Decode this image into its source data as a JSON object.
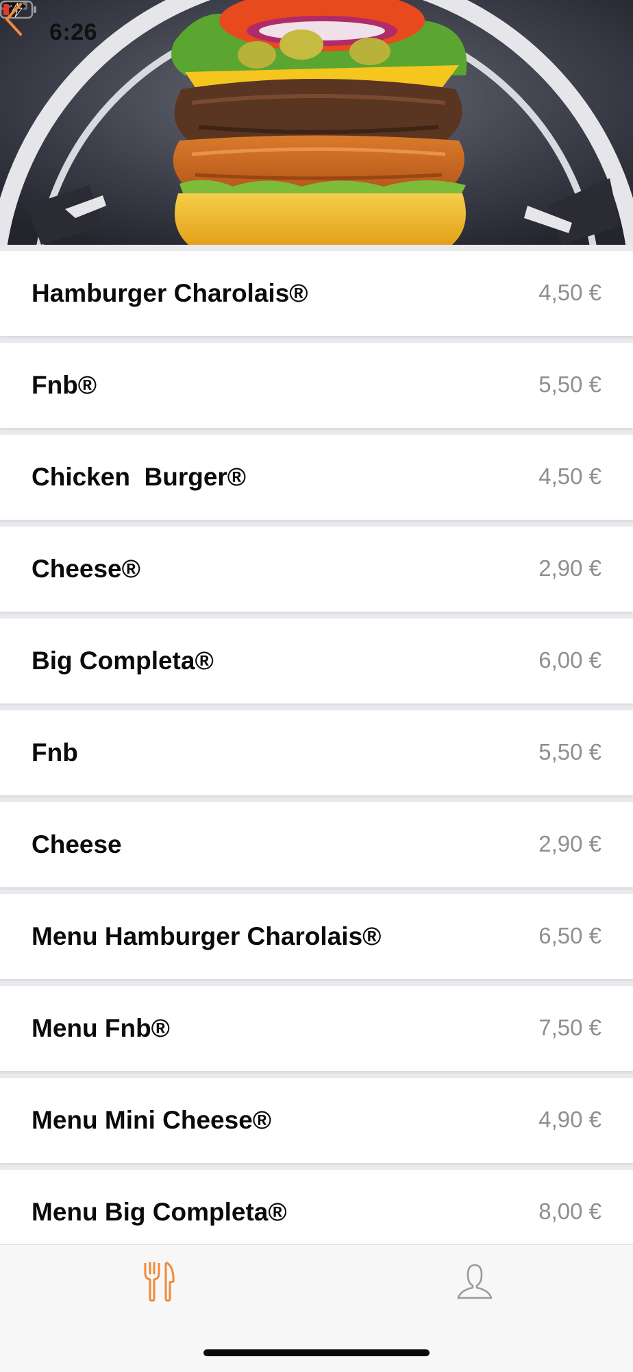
{
  "status_bar": {
    "time": "6:26"
  },
  "header": {
    "back_icon": "chevron-left-icon",
    "accent_color": "#f08a3a"
  },
  "menu": {
    "items": [
      {
        "name": "Hamburger Charolais®",
        "price": "4,50 €"
      },
      {
        "name": "Fnb®",
        "price": "5,50 €"
      },
      {
        "name": "Chicken  Burger®",
        "price": "4,50 €"
      },
      {
        "name": "Cheese®",
        "price": "2,90 €"
      },
      {
        "name": "Big Completa®",
        "price": "6,00 €"
      },
      {
        "name": "Fnb",
        "price": "5,50 €"
      },
      {
        "name": "Cheese",
        "price": "2,90 €"
      },
      {
        "name": "Menu Hamburger Charolais®",
        "price": "6,50 €"
      },
      {
        "name": "Menu Fnb®",
        "price": "7,50 €"
      },
      {
        "name": "Menu Mini Cheese®",
        "price": "4,90 €"
      },
      {
        "name": "Menu Big Completa®",
        "price": "8,00 €"
      }
    ]
  },
  "tab_bar": {
    "tabs": [
      {
        "icon": "fork-knife-icon",
        "active": true
      },
      {
        "icon": "user-icon",
        "active": false
      }
    ],
    "active_color": "#f08a3a",
    "inactive_color": "#9a9aa0"
  }
}
